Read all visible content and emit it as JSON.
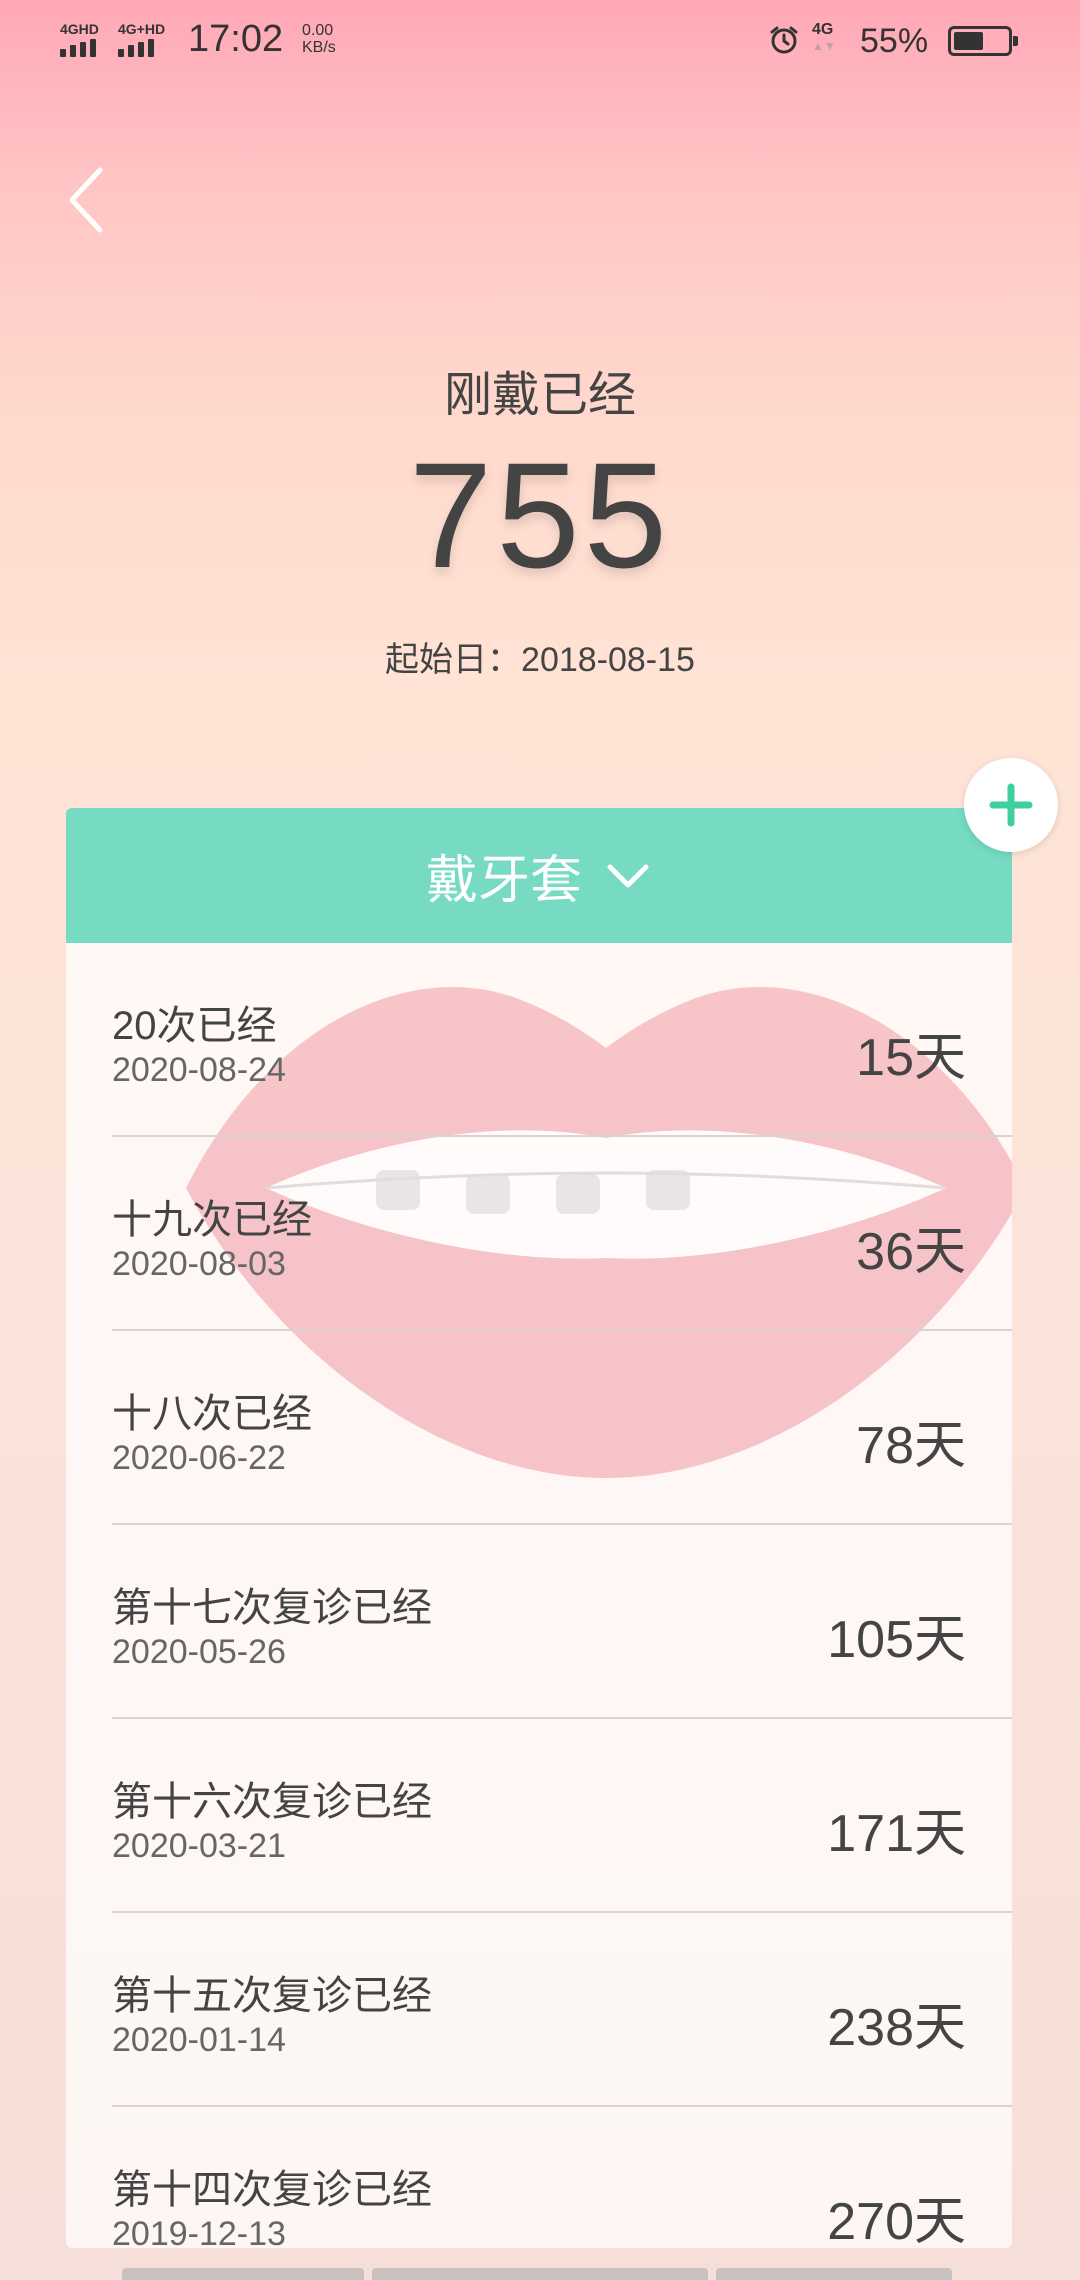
{
  "status_bar": {
    "signal1": "4GHD",
    "signal2": "4G+HD",
    "time": "17:02",
    "speed_value": "0.00",
    "speed_unit": "KB/s",
    "network": "4G",
    "battery_percent_text": "55%",
    "battery_level": 0.55
  },
  "hero": {
    "label": "刚戴已经",
    "value": "755",
    "start_date": "起始日：2018-08-15"
  },
  "card": {
    "header_label": "戴牙套",
    "accent_color": "#76dbc2",
    "rows": [
      {
        "title": "20次已经",
        "date": "2020-08-24",
        "days": "15天"
      },
      {
        "title": "十九次已经",
        "date": "2020-08-03",
        "days": "36天"
      },
      {
        "title": "十八次已经",
        "date": "2020-06-22",
        "days": "78天"
      },
      {
        "title": "第十七次复诊已经",
        "date": "2020-05-26",
        "days": "105天"
      },
      {
        "title": "第十六次复诊已经",
        "date": "2020-03-21",
        "days": "171天"
      },
      {
        "title": "第十五次复诊已经",
        "date": "2020-01-14",
        "days": "238天"
      },
      {
        "title": "第十四次复诊已经",
        "date": "2019-12-13",
        "days": "270天"
      }
    ]
  },
  "icons": {
    "back": "back-icon",
    "add": "plus-icon",
    "dropdown": "chevron-down-icon",
    "alarm": "alarm-icon",
    "battery": "battery-icon"
  }
}
